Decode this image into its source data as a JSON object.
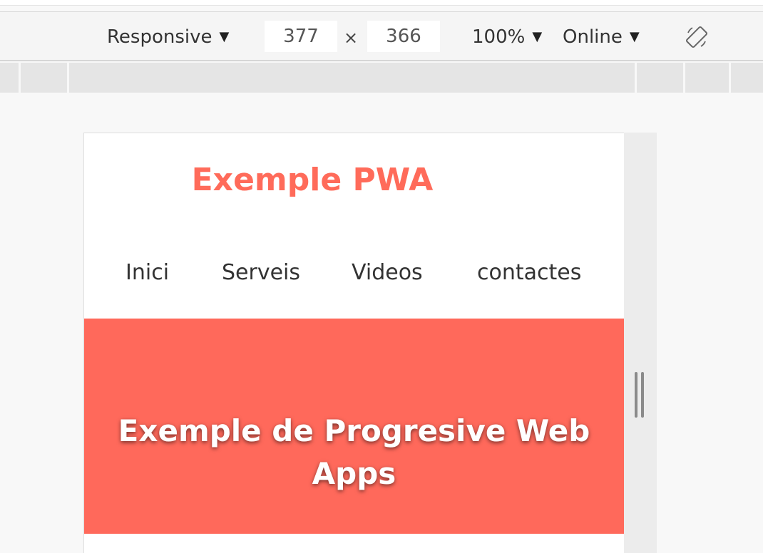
{
  "devtools": {
    "device_mode": "Responsive",
    "width": "377",
    "times": "×",
    "height": "366",
    "zoom": "100%",
    "throttling": "Online",
    "icons": {
      "caret": "caret-down-icon",
      "rotate": "rotate-icon"
    }
  },
  "page": {
    "site_title": "Exemple PWA",
    "nav": [
      "Inici",
      "Serveis",
      "Videos",
      "contactes"
    ],
    "hero_title": "Exemple de Progresive Web Apps"
  },
  "colors": {
    "accent": "#ff6b5a",
    "hero_bg": "#ff695b",
    "text": "#333333"
  }
}
